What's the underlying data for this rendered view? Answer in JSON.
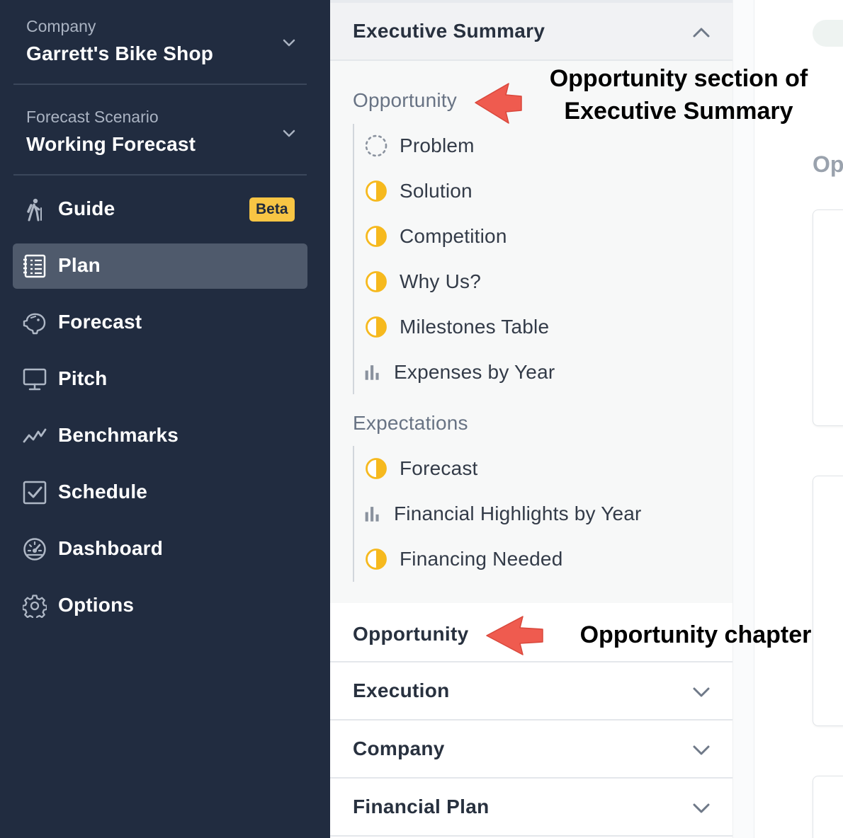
{
  "sidebar": {
    "company": {
      "label": "Company",
      "value": "Garrett's Bike Shop"
    },
    "scenario": {
      "label": "Forecast Scenario",
      "value": "Working Forecast"
    },
    "nav": [
      {
        "label": "Guide",
        "icon": "hiker-icon",
        "badge": "Beta",
        "active": false
      },
      {
        "label": "Plan",
        "icon": "plan-document-icon",
        "active": true
      },
      {
        "label": "Forecast",
        "icon": "piggy-bank-icon",
        "active": false
      },
      {
        "label": "Pitch",
        "icon": "monitor-icon",
        "active": false
      },
      {
        "label": "Benchmarks",
        "icon": "trend-line-icon",
        "active": false
      },
      {
        "label": "Schedule",
        "icon": "checkbox-calendar-icon",
        "active": false
      },
      {
        "label": "Dashboard",
        "icon": "gauge-icon",
        "active": false
      },
      {
        "label": "Options",
        "icon": "gear-icon",
        "active": false
      }
    ]
  },
  "outline": {
    "executive_summary": {
      "title": "Executive Summary",
      "groups": [
        {
          "title": "Opportunity",
          "items": [
            {
              "label": "Problem",
              "status": "not-started"
            },
            {
              "label": "Solution",
              "status": "in-progress"
            },
            {
              "label": "Competition",
              "status": "in-progress"
            },
            {
              "label": "Why Us?",
              "status": "in-progress"
            },
            {
              "label": "Milestones Table",
              "status": "in-progress"
            },
            {
              "label": "Expenses by Year",
              "status": "chart"
            }
          ]
        },
        {
          "title": "Expectations",
          "items": [
            {
              "label": "Forecast",
              "status": "in-progress"
            },
            {
              "label": "Financial Highlights by Year",
              "status": "chart"
            },
            {
              "label": "Financing Needed",
              "status": "in-progress"
            }
          ]
        }
      ]
    },
    "chapters": [
      {
        "title": "Opportunity"
      },
      {
        "title": "Execution"
      },
      {
        "title": "Company"
      },
      {
        "title": "Financial Plan"
      }
    ]
  },
  "preview": {
    "heading_peek": "Op"
  },
  "annotations": {
    "exec_opportunity": "Opportunity section of\nExecutive Summary",
    "chapter": "Opportunity chapter"
  },
  "colors": {
    "sidebar_bg": "#212c40",
    "active_nav": "#4f5a6c",
    "badge": "#f8c544",
    "status_yellow": "#f6b91e",
    "arrow_red": "#ef5b4f"
  }
}
